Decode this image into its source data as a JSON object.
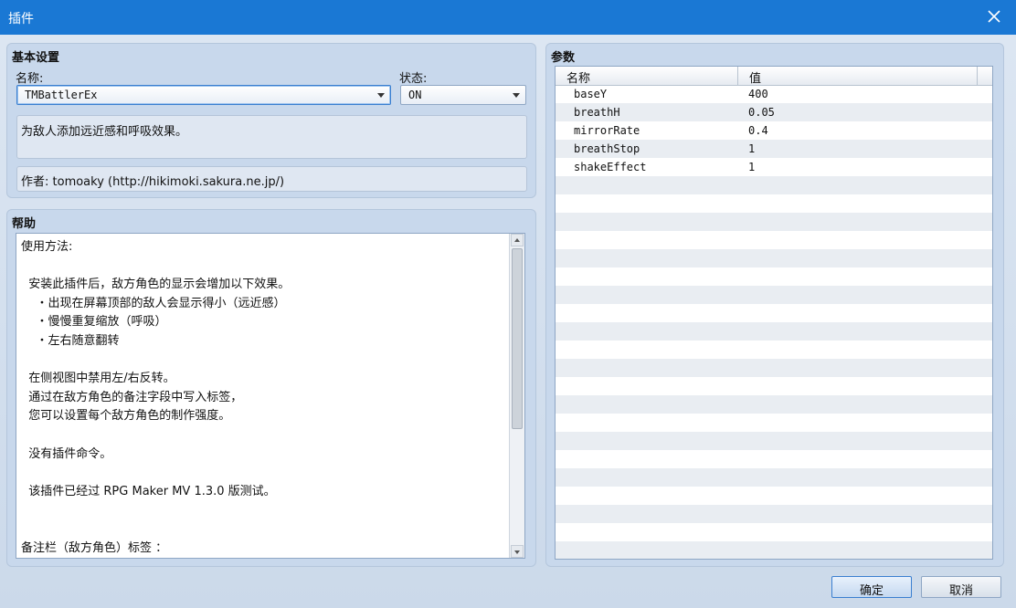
{
  "window": {
    "title": "插件"
  },
  "basic": {
    "title": "基本设置",
    "name_label": "名称:",
    "name_value": "TMBattlerEx",
    "status_label": "状态:",
    "status_value": "ON",
    "description": "为敌人添加远近感和呼吸效果。",
    "author": "作者: tomoaky (http://hikimoki.sakura.ne.jp/)"
  },
  "help": {
    "title": "帮助",
    "text": "使用方法:\n\n  安装此插件后，敌方角色的显示会增加以下效果。\n    ・出现在屏幕顶部的敌人会显示得小（远近感）\n    ・慢慢重复缩放（呼吸）\n    ・左右随意翻转\n\n  在侧视图中禁用左/右反转。\n  通过在敌方角色的备注字段中写入标签，\n  您可以设置每个敌方角色的制作强度。\n\n  没有插件命令。\n\n  该插件已经过 RPG Maker MV 1.3.0 版测试。\n\n\n备注栏（敌方角色）标签 ："
  },
  "params": {
    "title": "参数",
    "col_name": "名称",
    "col_value": "值",
    "rows": [
      {
        "name": "baseY",
        "value": "400"
      },
      {
        "name": "breathH",
        "value": "0.05"
      },
      {
        "name": "mirrorRate",
        "value": "0.4"
      },
      {
        "name": "breathStop",
        "value": "1"
      },
      {
        "name": "shakeEffect",
        "value": "1"
      }
    ]
  },
  "buttons": {
    "ok": "确定",
    "cancel": "取消"
  }
}
